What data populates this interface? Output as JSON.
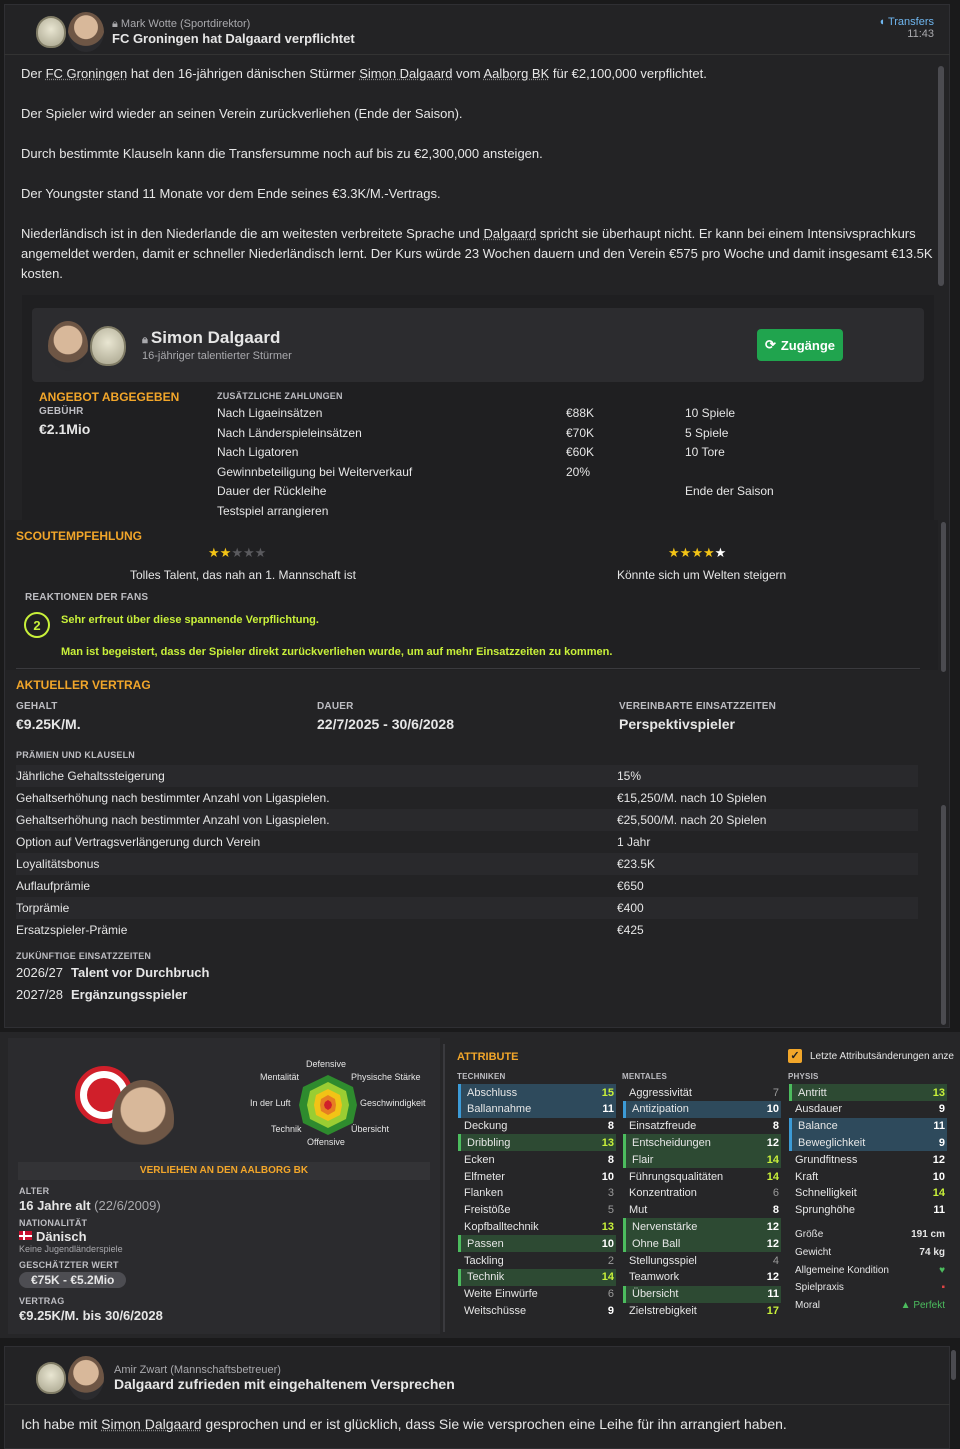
{
  "news1": {
    "sender": "Mark Wotte",
    "role": "(Sportdirektor)",
    "headline": "FC Groningen hat Dalgaard verpflichtet",
    "category": "Transfers",
    "time": "11:43",
    "p1a": "Der ",
    "p1b": "FC Groningen",
    "p1c": " hat den 16-jährigen dänischen Stürmer ",
    "p1d": "Simon Dalgaard",
    "p1e": " vom ",
    "p1f": "Aalborg BK",
    "p1g": " für €2,100,000 verpflichtet.",
    "p2": "Der Spieler wird wieder an seinen Verein zurückverliehen (Ende der Saison).",
    "p3": "Durch bestimmte Klauseln kann die Transfersumme noch auf bis zu €2,300,000 ansteigen.",
    "p4": "Der Youngster stand 11 Monate vor dem Ende seines €3.3K/M.-Vertrags.",
    "p5a": "Niederländisch ist in den Niederlande die am weitesten verbreitete Sprache und ",
    "p5b": "Dalgaard",
    "p5c": " spricht sie überhaupt nicht. Er kann bei einem Intensivsprachkurs angemeldet werden, damit er schneller Niederländisch lernt. Der Kurs würde 23 Wochen dauern und den Verein €575 pro Woche und damit insgesamt €13.5K kosten."
  },
  "player_card": {
    "name": "Simon Dalgaard",
    "subtitle": "16-jähriger talentierter Stürmer",
    "button": "Zugänge"
  },
  "offer": {
    "status": "ANGEBOT ABGEGEBEN",
    "fee_label": "GEBÜHR",
    "fee": "€2.1Mio",
    "extra_label": "ZUSÄTZLICHE ZAHLUNGEN",
    "rows": [
      {
        "label": "Nach Ligaeinsätzen",
        "amount": "€88K",
        "cond": "10 Spiele"
      },
      {
        "label": "Nach Länderspieleinsätzen",
        "amount": "€70K",
        "cond": "5 Spiele"
      },
      {
        "label": "Nach Ligatoren",
        "amount": "€60K",
        "cond": "10 Tore"
      },
      {
        "label": "Gewinnbeteiligung bei Weiterverkauf",
        "amount": "20%",
        "cond": ""
      },
      {
        "label": "Dauer der Rückleihe",
        "amount": "",
        "cond": "Ende der Saison"
      },
      {
        "label": "Testspiel arrangieren",
        "amount": "",
        "cond": ""
      }
    ]
  },
  "scout": {
    "title": "SCOUTEMPFEHLUNG",
    "current_text": "Tolles Talent, das nah an 1. Mannschaft ist",
    "current_stars": 2,
    "potential_text": "Könnte sich um Welten steigern",
    "potential_stars": 4,
    "fans_label": "REAKTIONEN DER FANS",
    "fans_count": "2",
    "fans_1": "Sehr erfreut über diese spannende Verpflichtung.",
    "fans_2": "Man ist begeistert, dass der Spieler direkt zurückverliehen wurde, um auf mehr Einsatzzeiten zu kommen."
  },
  "contract": {
    "title": "AKTUELLER VERTRAG",
    "salary_label": "GEHALT",
    "salary": "€9.25K/M.",
    "duration_label": "DAUER",
    "duration": "22/7/2025 - 30/6/2028",
    "role_label": "VEREINBARTE EINSATZZEITEN",
    "role": "Perspektivspieler",
    "bonus_label": "PRÄMIEN UND KLAUSELN",
    "bonuses": [
      {
        "label": "Jährliche Gehaltssteigerung",
        "value": "15%"
      },
      {
        "label": "Gehaltserhöhung nach bestimmter Anzahl von Ligaspielen.",
        "value": "€15,250/M. nach 10 Spielen"
      },
      {
        "label": "Gehaltserhöhung nach bestimmter Anzahl von Ligaspielen.",
        "value": "€25,500/M. nach 20 Spielen"
      },
      {
        "label": "Option auf Vertragsverlängerung durch Verein",
        "value": "1 Jahr"
      },
      {
        "label": "Loyalitätsbonus",
        "value": "€23.5K"
      },
      {
        "label": "Auflaufprämie",
        "value": "€650"
      },
      {
        "label": "Torprämie",
        "value": "€400"
      },
      {
        "label": "Ersatzspieler-Prämie",
        "value": "€425"
      }
    ],
    "future_label": "ZUKÜNFTIGE EINSATZZEITEN",
    "future": [
      {
        "season": "2026/27",
        "role": "Talent vor Durchbruch"
      },
      {
        "season": "2027/28",
        "role": "Ergänzungsspieler"
      }
    ]
  },
  "profile": {
    "radar": {
      "top": "Defensive",
      "tl": "Mentalität",
      "tr": "Physische Stärke",
      "l": "In der Luft",
      "r": "Geschwindigkeit",
      "bl": "Technik",
      "br": "Übersicht",
      "bottom": "Offensive"
    },
    "loan_banner": "VERLIEHEN AN DEN AALBORG BK",
    "age_label": "ALTER",
    "age": "16 Jahre alt",
    "dob": "(22/6/2009)",
    "nat_label": "NATIONALITÄT",
    "nat": "Dänisch",
    "nat_sub": "Keine Jugendländerspiele",
    "value_label": "GESCHÄTZTER WERT",
    "value": "€75K - €5.2Mio",
    "contract_label": "VERTRAG",
    "contract": "€9.25K/M. bis 30/6/2028"
  },
  "attributes": {
    "title": "ATTRIBUTE",
    "checkbox_label": "Letzte Attributsänderungen anze",
    "tech_label": "TECHNIKEN",
    "mental_label": "MENTALES",
    "phys_label": "PHYSIS",
    "tech": [
      [
        "Abschluss",
        "15"
      ],
      [
        "Ballannahme",
        "11"
      ],
      [
        "Deckung",
        "8"
      ],
      [
        "Dribbling",
        "13"
      ],
      [
        "Ecken",
        "8"
      ],
      [
        "Elfmeter",
        "10"
      ],
      [
        "Flanken",
        "3"
      ],
      [
        "Freistöße",
        "5"
      ],
      [
        "Kopfballtechnik",
        "13"
      ],
      [
        "Passen",
        "10"
      ],
      [
        "Tackling",
        "2"
      ],
      [
        "Technik",
        "14"
      ],
      [
        "Weite Einwürfe",
        "6"
      ],
      [
        "Weitschüsse",
        "9"
      ]
    ],
    "mental": [
      [
        "Aggressivität",
        "7"
      ],
      [
        "Antizipation",
        "10"
      ],
      [
        "Einsatzfreude",
        "8"
      ],
      [
        "Entscheidungen",
        "12"
      ],
      [
        "Flair",
        "14"
      ],
      [
        "Führungsqualitäten",
        "14"
      ],
      [
        "Konzentration",
        "6"
      ],
      [
        "Mut",
        "8"
      ],
      [
        "Nervenstärke",
        "12"
      ],
      [
        "Ohne Ball",
        "12"
      ],
      [
        "Stellungsspiel",
        "4"
      ],
      [
        "Teamwork",
        "12"
      ],
      [
        "Übersicht",
        "11"
      ],
      [
        "Zielstrebigkeit",
        "17"
      ]
    ],
    "phys": [
      [
        "Antritt",
        "13"
      ],
      [
        "Ausdauer",
        "9"
      ],
      [
        "Balance",
        "11"
      ],
      [
        "Beweglichkeit",
        "9"
      ],
      [
        "Grundfitness",
        "12"
      ],
      [
        "Kraft",
        "10"
      ],
      [
        "Schnelligkeit",
        "14"
      ],
      [
        "Sprunghöhe",
        "11"
      ]
    ],
    "info": [
      [
        "Größe",
        "191 cm"
      ],
      [
        "Gewicht",
        "74 kg"
      ],
      [
        "Allgemeine Kondition",
        ""
      ],
      [
        "Spielpraxis",
        ""
      ],
      [
        "Moral",
        "Perfekt"
      ]
    ]
  },
  "news2": {
    "sender": "Amir Zwart",
    "role": "(Mannschaftsbetreuer)",
    "headline": "Dalgaard zufrieden mit eingehaltenem Versprechen",
    "body_a": "Ich habe mit ",
    "body_b": "Simon Dalgaard",
    "body_c": " gesprochen und er ist glücklich, dass Sie wie versprochen eine Leihe für ihn arrangiert haben."
  }
}
